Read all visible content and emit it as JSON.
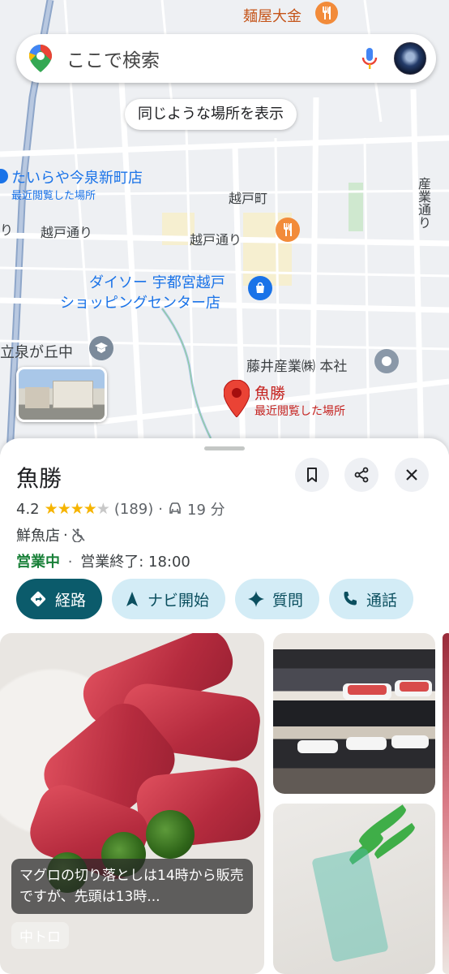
{
  "search": {
    "placeholder": "ここで検索"
  },
  "map": {
    "similar_places_button": "同じような場所を表示",
    "labels": {
      "top_restaurant": "麺屋大金",
      "tairaya_name": "たいらや今泉新町店",
      "tairaya_sub": "最近閲覧した場所",
      "koshido_town": "越戸町",
      "street_left_edge": "り",
      "koshido_street_1": "越戸通り",
      "koshido_street_2": "越戸通り",
      "sangyo_street": "産業通り",
      "daiso_line1": "ダイソー 宇都宮越戸",
      "daiso_line2": "ショッピングセンター店",
      "izumigaoka": "立泉が丘中",
      "fujii": "藤井産業㈱ 本社",
      "selected_name": "魚勝",
      "selected_sub": "最近閲覧した場所"
    }
  },
  "place": {
    "name": "魚勝",
    "rating": "4.2",
    "stars_filled": 4,
    "review_count": "(189)",
    "drive_time": "19 分",
    "category": "鮮魚店",
    "status": "営業中",
    "closing": "営業終了: 18:00",
    "separator": "·"
  },
  "actions": {
    "directions": "経路",
    "start_navi": "ナビ開始",
    "ask": "質問",
    "call": "通話"
  },
  "photos": {
    "caption": "マグロの切り落としは14時から販売ですが、先頭は13時...",
    "tag": "中トロ"
  },
  "colors": {
    "primary_chip": "#0b5b6b",
    "secondary_chip": "#d3ecf6",
    "open_green": "#188038",
    "pin_red": "#ea4335",
    "poi_blue": "#1a73e8",
    "star_gold": "#f6b400"
  },
  "icons": [
    "google-maps-logo-icon",
    "mic-icon",
    "avatar",
    "restaurant-icon",
    "shopping-icon",
    "school-icon",
    "business-icon",
    "place-pin-icon",
    "bookmark-icon",
    "share-icon",
    "close-icon",
    "car-icon",
    "no-wheelchair-icon",
    "directions-icon",
    "navigation-arrow-icon",
    "sparkle-icon",
    "phone-icon"
  ]
}
